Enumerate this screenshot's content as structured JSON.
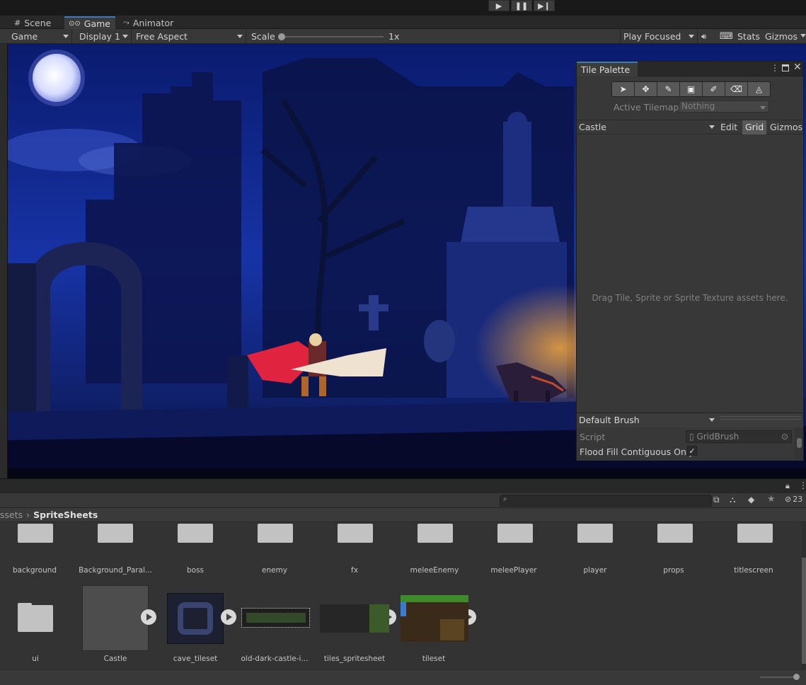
{
  "tabs": [
    {
      "label": "Scene",
      "icon": "grid-icon"
    },
    {
      "label": "Game",
      "icon": "gamepad-icon"
    },
    {
      "label": "Animator",
      "icon": "animator-icon"
    }
  ],
  "game_toolbar": {
    "view_mode": "Game",
    "display": "Display 1",
    "aspect": "Free Aspect",
    "scale_label": "Scale",
    "scale_value": "1x",
    "play_mode": "Play Focused",
    "stats": "Stats",
    "gizmos": "Gizmos"
  },
  "tile_palette": {
    "title": "Tile Palette",
    "tools": [
      "select-icon",
      "move-icon",
      "paint-brush-icon",
      "box-fill-icon",
      "picker-icon",
      "eraser-icon",
      "fill-bucket-icon"
    ],
    "active_tilemap_label": "Active Tilemap",
    "active_tilemap_value": "Nothing",
    "palette_name": "Castle",
    "edit": "Edit",
    "grid": "Grid",
    "gizmos": "Gizmos",
    "empty_hint": "Drag Tile, Sprite or Sprite Texture assets here.",
    "brush": "Default Brush",
    "script_label": "Script",
    "script_value": "GridBrush",
    "flood_fill_label": "Flood Fill Contiguous Only",
    "flood_fill_checked": true
  },
  "project": {
    "breadcrumb_parent": "ssets",
    "breadcrumb_current": "SpriteSheets",
    "hidden_count": "23",
    "folders_row1": [
      "background",
      "Background_Paral...",
      "boss",
      "enemy",
      "fx",
      "meleeEnemy",
      "meleePlayer",
      "player",
      "props",
      "titlescreen"
    ],
    "row2": [
      {
        "label": "ui",
        "kind": "folder"
      },
      {
        "label": "Castle",
        "kind": "palette"
      },
      {
        "label": "cave_tileset",
        "kind": "sprite"
      },
      {
        "label": "old-dark-castle-i...",
        "kind": "sprite"
      },
      {
        "label": "tiles_spritesheet",
        "kind": "sprite"
      },
      {
        "label": "tileset",
        "kind": "sprite"
      }
    ]
  }
}
